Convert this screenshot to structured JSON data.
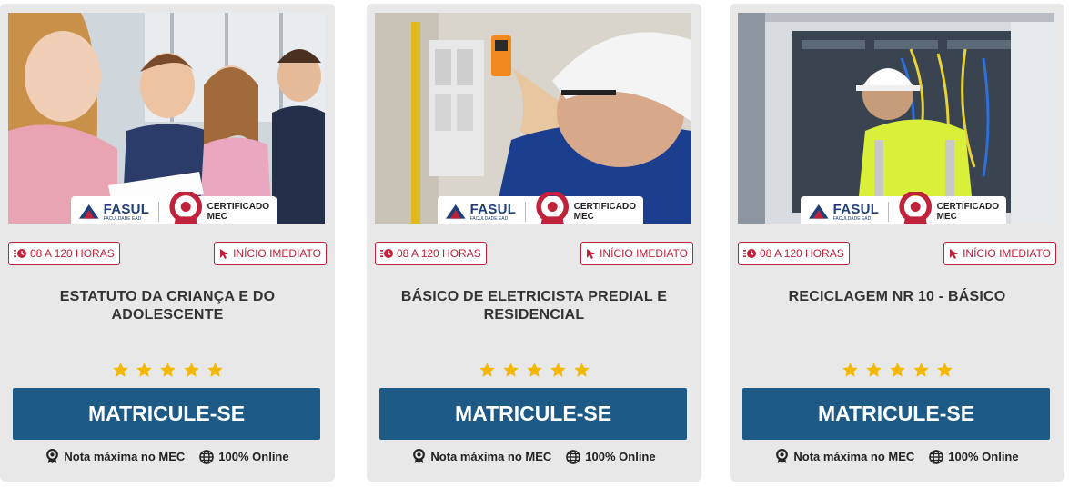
{
  "colors": {
    "accent": "#c0223b",
    "button": "#1d5a86",
    "star": "#f5b800",
    "card": "#e8e8e8"
  },
  "brand": {
    "name": "FASUL",
    "sub": "FACULDADE EAD",
    "cert": "CERTIFICADO MEC"
  },
  "courses": [
    {
      "image": "electrician-working-on-panel",
      "hours": "08 A 120 HORAS",
      "start": "INÍCIO IMEDIATO",
      "title": "BÁSICO DE ELETRICISTA PREDIAL E RESIDENCIAL",
      "rating": 5,
      "cta": "MATRICULE-SE",
      "footer": {
        "mec": "Nota máxima no MEC",
        "online": "100% Online"
      }
    },
    {
      "image": "technician-at-electrical-cabinet",
      "hours": "08 A 120 HORAS",
      "start": "INÍCIO IMEDIATO",
      "title": "RECICLAGEM NR 10 - BÁSICO",
      "rating": 5,
      "cta": "MATRICULE-SE",
      "footer": {
        "mec": "Nota máxima no MEC",
        "online": "100% Online"
      }
    },
    {
      "image": "children-reading-together",
      "hours": "08 A 120 HORAS",
      "start": "INÍCIO IMEDIATO",
      "title": "ESTATUTO DA CRIANÇA E DO ADOLESCENTE",
      "rating": 5,
      "cta": "MATRICULE-SE",
      "footer": {
        "mec": "Nota máxima no MEC",
        "online": "100% Online"
      }
    }
  ]
}
